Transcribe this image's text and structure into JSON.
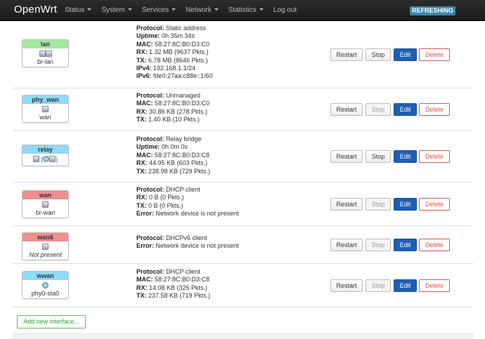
{
  "navbar": {
    "brand": "OpenWrt",
    "menu": [
      "Status",
      "System",
      "Services",
      "Network",
      "Statistics",
      "Log out"
    ],
    "status_badge": "REFRESHING"
  },
  "colors": {
    "green": "#a5e6a0",
    "blue": "#8fdaf5",
    "red": "#f08f8f",
    "edit_button": "#1e5fb4",
    "delete_button": "#d9534f"
  },
  "interfaces": [
    {
      "name": "lan",
      "color": "green",
      "icons": "dev-dev",
      "device": "br-lan",
      "device_italic": false,
      "info": [
        [
          "Protocol:",
          "Static address"
        ],
        [
          "Uptime:",
          "0h 35m 34s"
        ],
        [
          "MAC:",
          "58:27:8C:B0:D3:C0"
        ],
        [
          "RX:",
          "1.32 MB (9637 Pkts.)"
        ],
        [
          "TX:",
          "6.78 MB (8646 Pkts.)"
        ],
        [
          "IPv4:",
          "192.168.1.1/24"
        ],
        [
          "IPv6:",
          "fde0:27aa:c88e::1/60"
        ]
      ],
      "stop_disabled": false
    },
    {
      "name": "phy_wan",
      "color": "blue",
      "icons": "dev",
      "device": "wan",
      "device_italic": false,
      "info": [
        [
          "Protocol:",
          "Unmanaged"
        ],
        [
          "MAC:",
          "58:27:8C:B0:D3:C0"
        ],
        [
          "RX:",
          "30.86 KB (278 Pkts.)"
        ],
        [
          "TX:",
          "1.40 KB (10 Pkts.)"
        ]
      ],
      "stop_disabled": true
    },
    {
      "name": "relay",
      "color": "blue",
      "icons": "relay",
      "device": "",
      "device_italic": false,
      "info": [
        [
          "Protocol:",
          "Relay bridge"
        ],
        [
          "Uptime:",
          "0h 0m 0s"
        ],
        [
          "MAC:",
          "58:27:8C:B0:D3:C8"
        ],
        [
          "RX:",
          "44.95 KB (603 Pkts.)"
        ],
        [
          "TX:",
          "238.98 KB (729 Pkts.)"
        ]
      ],
      "stop_disabled": false
    },
    {
      "name": "wan",
      "color": "red",
      "icons": "dev",
      "device": "br-wan",
      "device_italic": false,
      "info": [
        [
          "Protocol:",
          "DHCP client"
        ],
        [
          "RX:",
          "0 B (0 Pkts.)"
        ],
        [
          "TX:",
          "0 B (0 Pkts.)"
        ],
        [
          "Error:",
          "Network device is not present"
        ]
      ],
      "stop_disabled": true
    },
    {
      "name": "wan6",
      "color": "red",
      "icons": "dev",
      "device": "Not present",
      "device_italic": true,
      "info": [
        [
          "Protocol:",
          "DHCPv6 client"
        ],
        [
          "Error:",
          "Network device is not present"
        ]
      ],
      "stop_disabled": true
    },
    {
      "name": "wwan",
      "color": "blue",
      "icons": "wifi",
      "device": "phy0-sta0",
      "device_italic": false,
      "info": [
        [
          "Protocol:",
          "DHCP client"
        ],
        [
          "MAC:",
          "58:27:8C:B0:D3:C8"
        ],
        [
          "RX:",
          "14.08 KB (325 Pkts.)"
        ],
        [
          "TX:",
          "237.58 KB (719 Pkts.)"
        ]
      ],
      "stop_disabled": true
    }
  ],
  "buttons": {
    "restart": "Restart",
    "stop": "Stop",
    "edit": "Edit",
    "delete": "Delete"
  },
  "add_interface_label": "Add new interface..."
}
